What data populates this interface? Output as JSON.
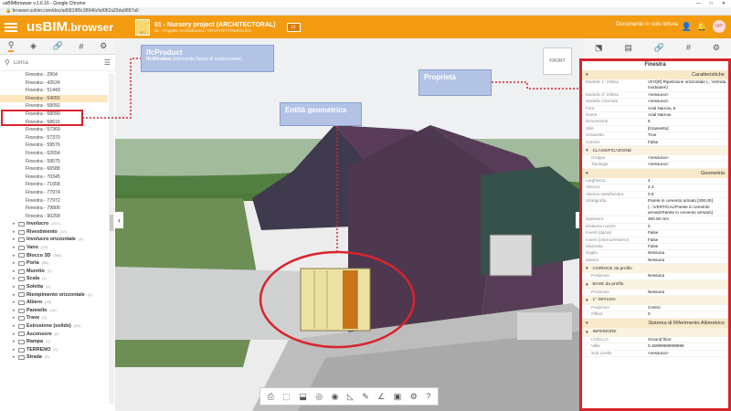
{
  "window": {
    "title": "usBIMbrowser v.1.6.16 - Google Chrome",
    "url": "browser.usbim.com/doc/ad5819f0c38946cfaf062a22da9897a6"
  },
  "app": {
    "logo_main": "usBIM",
    "logo_sub": ".browser",
    "project_title": "01 - Nursery project (ARCHITECTORAL)",
    "project_sub": "01 - Progetto Architettonico / ARCHITETTONICO.ifcx",
    "ifc_badge": "v1",
    "readonly_label": "Documento in solo lettura",
    "avatar": "MP",
    "accent": "#f39c12"
  },
  "left": {
    "search_placeholder": "Cerca",
    "tree_items": [
      "Finestra - 2904",
      "Finestra - 43534",
      "Finestra - 51443",
      "Finestra - 54055",
      "Finestra - 58092",
      "Finestra - 58090",
      "Finestra - 58616",
      "Finestra - 57369",
      "Finestra - 57370",
      "Finestra - 59576",
      "Finestra - 62654",
      "Finestra - 59575",
      "Finestra - 66588",
      "Finestra - 70345",
      "Finestra - 71658",
      "Finestra - 77974",
      "Finestra - 77972",
      "Finestra - 79806",
      "Finestra - 90258"
    ],
    "folders": [
      {
        "name": "Involucro",
        "count": "(317)"
      },
      {
        "name": "Rivestimento",
        "count": "(27)"
      },
      {
        "name": "Involucro orizzontale",
        "count": "(3)"
      },
      {
        "name": "Vano",
        "count": "(29)"
      },
      {
        "name": "Blocco 3D",
        "count": "(350)"
      },
      {
        "name": "Porta",
        "count": "(58)"
      },
      {
        "name": "Muretto",
        "count": "(2)"
      },
      {
        "name": "Scala",
        "count": "(1)"
      },
      {
        "name": "Soletta",
        "count": "(4)"
      },
      {
        "name": "Riempimento orizzontale",
        "count": "(1)"
      },
      {
        "name": "Albero",
        "count": "(99)"
      },
      {
        "name": "Pannello",
        "count": "(16)"
      },
      {
        "name": "Trave",
        "count": "(3)"
      },
      {
        "name": "Estrusione (solido)",
        "count": "(69)"
      },
      {
        "name": "Ascensore",
        "count": "(1)"
      },
      {
        "name": "Rampa",
        "count": "(1)"
      },
      {
        "name": "TERRENO",
        "count": "(1)"
      },
      {
        "name": "Strada",
        "count": "(3)"
      }
    ]
  },
  "callouts": {
    "ifc_title": "IfcProduct",
    "ifc_line2": "IfcWindow",
    "ifc_desc": "(elemento fisico di costruzione)",
    "geometry": "Entità geometrica",
    "properties": "Proprietà"
  },
  "viewer": {
    "cube_label": "FRONT"
  },
  "right": {
    "header": "Finestra",
    "sections": [
      {
        "title": "Caratteristiche",
        "rows": [
          [
            "Modello 1° infisso",
            "VFO[R] Ripetizione orizzontale (...\\Vetrata modulare\\)"
          ],
          [
            "Modello 2° infisso",
            "<nessuno>"
          ],
          [
            "Modello inferriata",
            "<nessuno>"
          ],
          [
            "Font",
            "Arial Narrow, 6"
          ],
          [
            "Nome",
            "Arial Narrow"
          ],
          [
            "Dimensione",
            "6"
          ],
          [
            "Stile",
            "[Grassetto]"
          ],
          [
            "Grassetto",
            "True"
          ],
          [
            "Corsivo",
            "False"
          ]
        ],
        "subsections": [
          {
            "title": "CLASSIFICAZIONE",
            "rows": [
              [
                "Gruppo",
                "<nessuno>"
              ],
              [
                "Tipologia",
                "<nessuno>"
              ]
            ]
          }
        ]
      },
      {
        "title": "Geometria",
        "rows": [
          [
            "Larghezza",
            "4"
          ],
          [
            "Altezza",
            "2.4"
          ],
          [
            "Altezza sottofinestra",
            "0.9"
          ],
          [
            "Stratigrafia",
            "Parete in cemento armato [300.00] (...\\VERTICAL\\Parete in cemento armato\\Parete in cemento armato\\)"
          ],
          [
            "Spessore",
            "300.00 mm"
          ],
          [
            "Distanza mazze",
            "0"
          ],
          [
            "Inverti (da/va)",
            "False"
          ],
          [
            "Inverti (interno/esterno)",
            "False"
          ],
          [
            "Mazzetta",
            "False"
          ],
          [
            "Soglia",
            "Nessuna"
          ],
          [
            "Mostra",
            "Nessuna"
          ]
        ],
        "subsections": [
          {
            "title": "CORNICE da profilo",
            "rows": [
              [
                "Posizione",
                "Nessuna"
              ]
            ]
          },
          {
            "title": "BASE da profilo",
            "rows": [
              [
                "Posizione",
                "Nessuna"
              ]
            ]
          },
          {
            "title": "1° INFISSO",
            "rows": [
              [
                "Posizione",
                "Centro"
              ],
              [
                "Offset",
                "0"
              ]
            ]
          }
        ]
      },
      {
        "title": "Sistema di Riferimento Altimetrico",
        "rows": [],
        "subsections": [
          {
            "title": "INFERIORE",
            "rows": [
              [
                "LIVELLO",
                "Ground floor"
              ],
              [
                "Valle",
                "0.15999999999999"
              ],
              [
                "Sub Livello",
                "<nessuno>"
              ]
            ]
          }
        ]
      }
    ]
  }
}
